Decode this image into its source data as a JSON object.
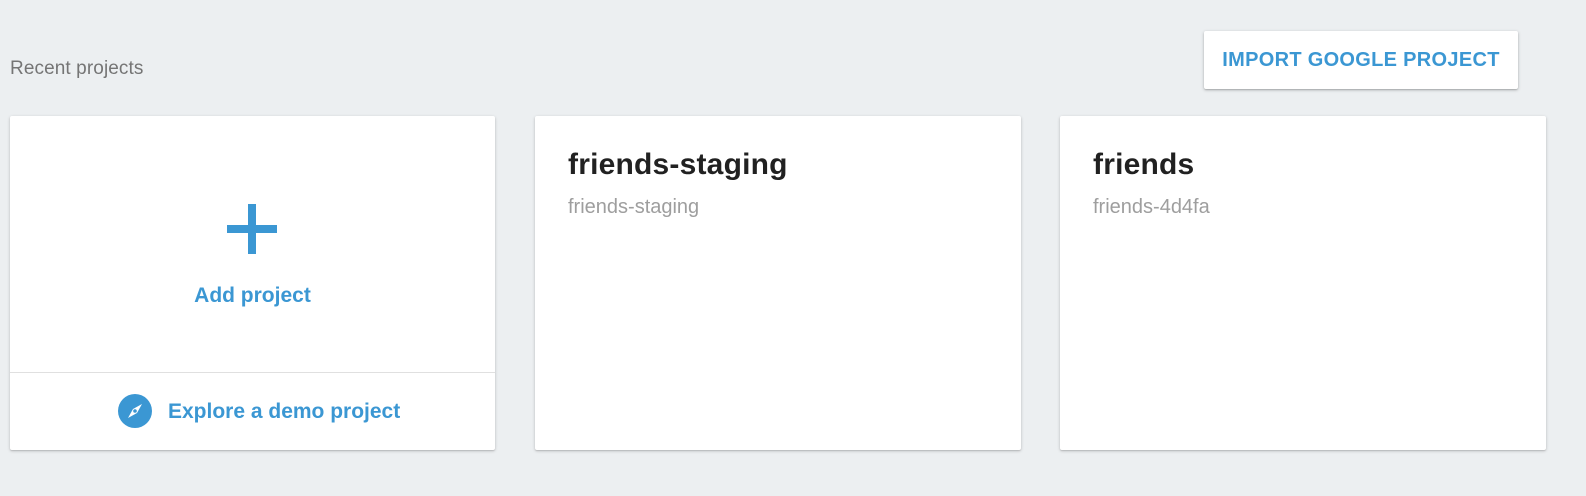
{
  "section": {
    "title": "Recent projects"
  },
  "toolbar": {
    "import_label": "IMPORT GOOGLE PROJECT"
  },
  "add_card": {
    "add_label": "Add project",
    "plus_icon": "plus-icon",
    "demo_label": "Explore a demo project",
    "demo_icon": "compass-icon"
  },
  "projects": [
    {
      "name": "friends-staging",
      "id": "friends-staging"
    },
    {
      "name": "friends",
      "id": "friends-4d4fa"
    }
  ],
  "colors": {
    "accent": "#3b97d3",
    "background": "#eceff1",
    "card": "#ffffff",
    "title_text": "#212121",
    "secondary_text": "#9e9e9e"
  }
}
